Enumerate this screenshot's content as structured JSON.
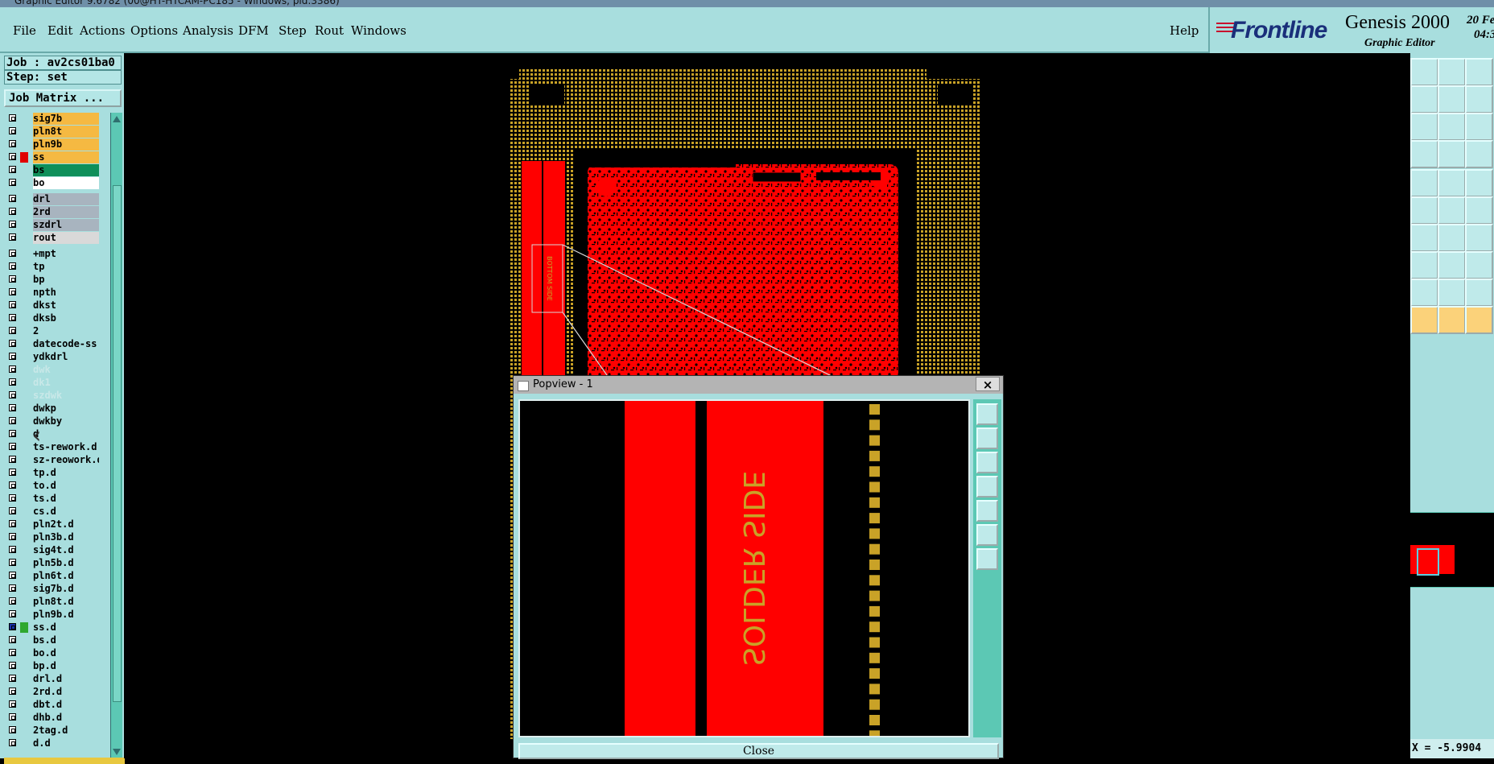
{
  "window": {
    "title": "Graphic Editor 9.6782 (00@HT-HTCAM-PC185 - Windows, pid:3386)"
  },
  "menu": {
    "items": [
      {
        "label": "File"
      },
      {
        "label": "Edit"
      },
      {
        "label": "Actions"
      },
      {
        "label": "Options"
      },
      {
        "label": "Analysis"
      },
      {
        "label": "DFM"
      },
      {
        "label": "Step"
      },
      {
        "label": "Rout"
      },
      {
        "label": "Windows"
      }
    ],
    "help": "Help"
  },
  "logo": {
    "brand": "Frontline",
    "product": "Genesis 2000",
    "subtitle": "Graphic Editor",
    "date_line1": "20 Fe",
    "date_line2": "04:3"
  },
  "left": {
    "job": "Job : av2cs01ba0",
    "step": "Step: set",
    "job_matrix": "Job Matrix ...",
    "layers": [
      {
        "name": "sig7b",
        "color": "#f5b942"
      },
      {
        "name": "pln8t",
        "color": "#f5b942"
      },
      {
        "name": "pln9b",
        "color": "#f5b942"
      },
      {
        "name": "ss",
        "color": "#f5b942",
        "marker": "#e00000"
      },
      {
        "name": "bs",
        "color": "#0f8f5a"
      },
      {
        "name": "bo",
        "color": "#ffffff"
      },
      {
        "name": "drl",
        "color": "#a8b4bf"
      },
      {
        "name": "2rd",
        "color": "#a8b4bf"
      },
      {
        "name": "szdrl",
        "color": "#a8b4bf"
      },
      {
        "name": "rout",
        "color": "#d9d9d9"
      },
      {
        "name": "+mpt",
        "color": "#a8dede"
      },
      {
        "name": "tp",
        "color": "#a8dede"
      },
      {
        "name": "bp",
        "color": "#a8dede"
      },
      {
        "name": "npth",
        "color": "#a8dede"
      },
      {
        "name": "dkst",
        "color": "#a8dede"
      },
      {
        "name": "dksb",
        "color": "#a8dede"
      },
      {
        "name": "2",
        "color": "#a8dede"
      },
      {
        "name": "datecode-ss",
        "color": "#a8dede"
      },
      {
        "name": "ydkdrl",
        "color": "#a8dede"
      },
      {
        "name": "dwk",
        "color": "#a8dede",
        "dim": true
      },
      {
        "name": "dk1",
        "color": "#a8dede",
        "dim": true
      },
      {
        "name": "szdwk",
        "color": "#a8dede",
        "dim": true
      },
      {
        "name": "dwkp",
        "color": "#a8dede"
      },
      {
        "name": "dwkby",
        "color": "#a8dede"
      },
      {
        "name": "d",
        "color": "#a8dede"
      },
      {
        "name": "ts-rework.d",
        "color": "#a8dede"
      },
      {
        "name": "sz-reowork.d",
        "color": "#a8dede"
      },
      {
        "name": "tp.d",
        "color": "#a8dede"
      },
      {
        "name": "to.d",
        "color": "#a8dede"
      },
      {
        "name": "ts.d",
        "color": "#a8dede"
      },
      {
        "name": "cs.d",
        "color": "#a8dede"
      },
      {
        "name": "pln2t.d",
        "color": "#a8dede"
      },
      {
        "name": "pln3b.d",
        "color": "#a8dede"
      },
      {
        "name": "sig4t.d",
        "color": "#a8dede"
      },
      {
        "name": "pln5b.d",
        "color": "#a8dede"
      },
      {
        "name": "pln6t.d",
        "color": "#a8dede"
      },
      {
        "name": "sig7b.d",
        "color": "#a8dede"
      },
      {
        "name": "pln8t.d",
        "color": "#a8dede"
      },
      {
        "name": "pln9b.d",
        "color": "#a8dede"
      },
      {
        "name": "ss.d",
        "color": "#a8dede",
        "marker": "#2fa82f",
        "selected": true
      },
      {
        "name": "bs.d",
        "color": "#a8dede"
      },
      {
        "name": "bo.d",
        "color": "#a8dede"
      },
      {
        "name": "bp.d",
        "color": "#a8dede"
      },
      {
        "name": "drl.d",
        "color": "#a8dede"
      },
      {
        "name": "2rd.d",
        "color": "#a8dede"
      },
      {
        "name": "dbt.d",
        "color": "#a8dede"
      },
      {
        "name": "dhb.d",
        "color": "#a8dede"
      },
      {
        "name": "2tag.d",
        "color": "#a8dede"
      },
      {
        "name": "d.d",
        "color": "#a8dede"
      }
    ]
  },
  "popview": {
    "title": "Popview - 1",
    "close_x": "×",
    "close_button": "Close",
    "silkscreen_text": "SOLDER SIDE"
  },
  "board": {
    "silkscreen_small": "BOTTOM SIDE"
  },
  "right": {
    "coords": "X = -5.9904"
  },
  "colors": {
    "panel": "#a8dede",
    "copper": "#ff0000",
    "pads": "#c9a227",
    "tool_accent": "#fbd27a"
  }
}
